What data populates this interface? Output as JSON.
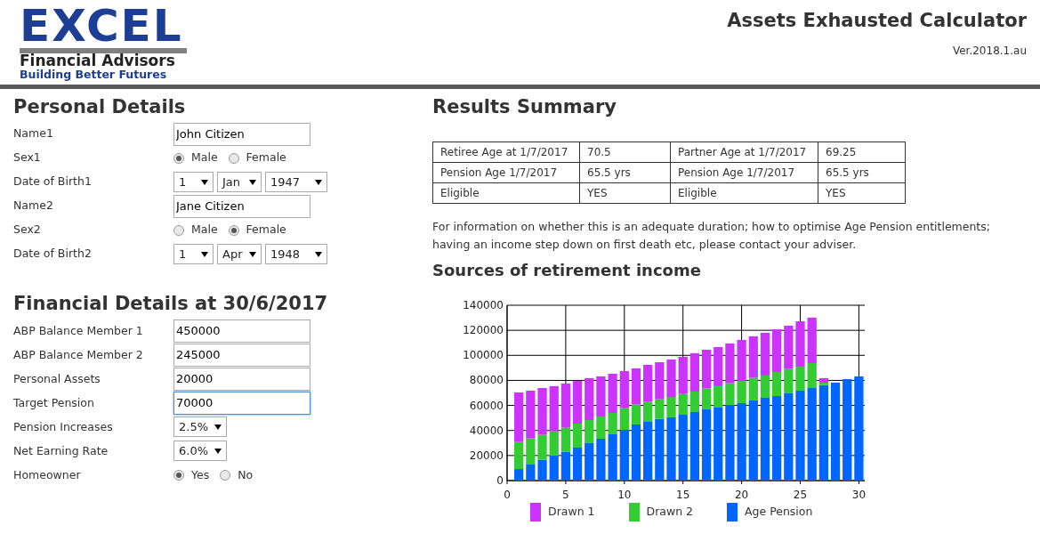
{
  "logo": {
    "wordmark": "EXCEL",
    "line1": "Financial Advisors",
    "line2": "Building Better Futures"
  },
  "header": {
    "title": "Assets Exhausted Calculator",
    "version": "Ver.2018.1.au"
  },
  "personal": {
    "title": "Personal Details",
    "fields": [
      {
        "kind": "text",
        "label": "Name1",
        "value": "John Citizen"
      },
      {
        "kind": "radio",
        "label": "Sex1",
        "options": [
          {
            "label": "Male",
            "selected": true
          },
          {
            "label": "Female",
            "selected": false
          }
        ]
      },
      {
        "kind": "selects",
        "label": "Date of Birth1",
        "selects": [
          "1",
          "Jan",
          "1947"
        ]
      },
      {
        "kind": "text",
        "label": "Name2",
        "value": "Jane Citizen"
      },
      {
        "kind": "radio",
        "label": "Sex2",
        "options": [
          {
            "label": "Male",
            "selected": false
          },
          {
            "label": "Female",
            "selected": true
          }
        ]
      },
      {
        "kind": "selects",
        "label": "Date of Birth2",
        "selects": [
          "1",
          "Apr",
          "1948"
        ]
      }
    ]
  },
  "financial": {
    "title": "Financial Details at 30/6/2017",
    "fields": [
      {
        "kind": "text",
        "label": "ABP Balance Member 1",
        "value": "450000",
        "focused": false
      },
      {
        "kind": "text",
        "label": "ABP Balance Member 2",
        "value": "245000",
        "focused": false
      },
      {
        "kind": "text",
        "label": "Personal Assets",
        "value": "20000",
        "focused": false
      },
      {
        "kind": "text",
        "label": "Target Pension",
        "value": "70000",
        "focused": true
      },
      {
        "kind": "selects",
        "label": "Pension Increases",
        "selects": [
          "2.5%"
        ]
      },
      {
        "kind": "selects",
        "label": "Net Earning Rate",
        "selects": [
          "6.0%"
        ]
      },
      {
        "kind": "radio",
        "label": "Homeowner",
        "options": [
          {
            "label": "Yes",
            "selected": true
          },
          {
            "label": "No",
            "selected": false
          }
        ]
      }
    ]
  },
  "results": {
    "title": "Results Summary",
    "rows": [
      [
        "Retiree Age at 1/7/2017",
        "70.5",
        "Partner Age at 1/7/2017",
        "69.25"
      ],
      [
        "Pension Age 1/7/2017",
        "65.5 yrs",
        "Pension Age 1/7/2017",
        "65.5 yrs"
      ],
      [
        "Eligible",
        "YES",
        "Eligible",
        "YES"
      ]
    ],
    "note": "For information on whether this is an adequate duration; how to optimise Age Pension entitlements; having an income step down on first death etc, please contact your adviser."
  },
  "income": {
    "title": "Sources of retirement income",
    "chart_data": {
      "type": "bar",
      "stacked": true,
      "x": [
        1,
        2,
        3,
        4,
        5,
        6,
        7,
        8,
        9,
        10,
        11,
        12,
        13,
        14,
        15,
        16,
        17,
        18,
        19,
        20,
        21,
        22,
        23,
        24,
        25,
        26,
        27,
        28,
        29,
        30
      ],
      "series": [
        {
          "name": "Age Pension",
          "color": "#0066ff",
          "values": [
            9200,
            12800,
            16600,
            19900,
            23000,
            26300,
            29900,
            33400,
            37000,
            40500,
            44800,
            46900,
            49300,
            50500,
            52600,
            54700,
            56900,
            58300,
            60400,
            61800,
            64000,
            66100,
            67500,
            69700,
            71800,
            73900,
            76300,
            78200,
            81000,
            83200
          ]
        },
        {
          "name": "Drawn 2",
          "color": "#33cc33",
          "values": [
            21600,
            20800,
            19900,
            19400,
            19200,
            19200,
            18400,
            17800,
            17000,
            17300,
            15900,
            15900,
            15600,
            16300,
            16600,
            16400,
            16600,
            17100,
            17300,
            17800,
            18000,
            17800,
            19200,
            19400,
            19200,
            19900,
            1900,
            0,
            0,
            0
          ]
        },
        {
          "name": "Drawn 1",
          "color": "#cc33ff",
          "values": [
            39600,
            38200,
            37400,
            36100,
            35300,
            34100,
            33500,
            32000,
            31300,
            29600,
            28900,
            29600,
            29600,
            29900,
            29600,
            30600,
            31000,
            31200,
            31800,
            32700,
            33200,
            34100,
            34100,
            34600,
            36200,
            36300,
            3600,
            0,
            0,
            0
          ]
        }
      ],
      "xlim": [
        0,
        30.5
      ],
      "ylim": [
        0,
        140000
      ],
      "xticks": [
        0,
        5,
        10,
        15,
        20,
        25,
        30
      ],
      "yticks": [
        0,
        20000,
        40000,
        60000,
        80000,
        100000,
        120000,
        140000
      ],
      "grid": true,
      "legend": "bottom"
    }
  }
}
